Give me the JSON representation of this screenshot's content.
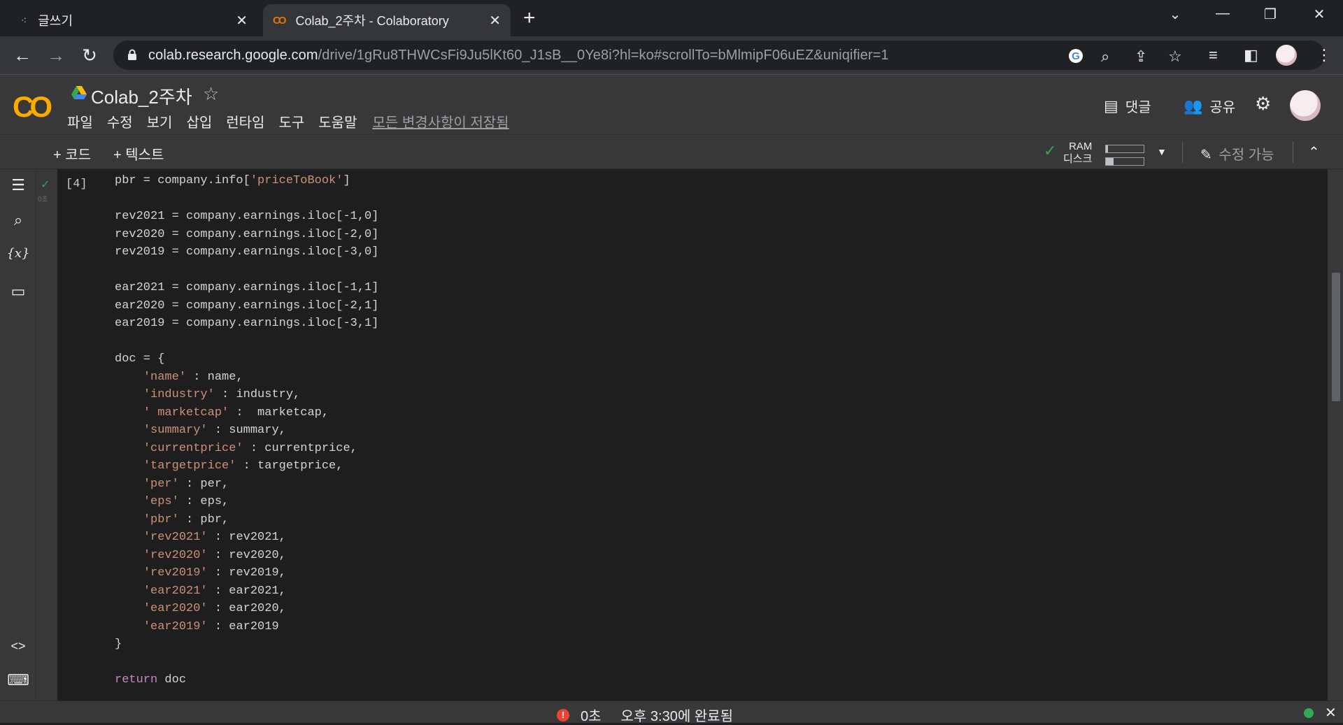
{
  "browser": {
    "tabs": [
      {
        "title": "글쓰기",
        "close": "✕"
      },
      {
        "title": "Colab_2주차 - Colaboratory",
        "close": "✕"
      }
    ],
    "new_tab": "+",
    "url_host": "colab.research.google.com",
    "url_path": "/drive/1gRu8THWCsFi9Ju5lKt60_J1sB__0Ye8i?hl=ko#scrollTo=bMlmipF06uEZ&uniqifier=1"
  },
  "colab": {
    "logo": "CO",
    "notebook_title": "Colab_2주차",
    "menu": [
      "파일",
      "수정",
      "보기",
      "삽입",
      "런타임",
      "도구",
      "도움말"
    ],
    "saved_status": "모든 변경사항이 저장됨",
    "comment_label": "댓글",
    "share_label": "공유",
    "add_code": "+ 코드",
    "add_text": "+ 텍스트",
    "ram_label": "RAM",
    "disk_label": "디스크",
    "ram_usage": 0.06,
    "disk_usage": 0.2,
    "edit_mode": "수정 가능"
  },
  "cell": {
    "exec_count": "[4]",
    "run_time": "0초",
    "code_lines": [
      [
        {
          "t": "pbr = company.info["
        },
        {
          "t": "'priceToBook'",
          "c": "str"
        },
        {
          "t": "]"
        }
      ],
      [],
      [
        {
          "t": "rev2021 = company.earnings.iloc[-1,0]"
        }
      ],
      [
        {
          "t": "rev2020 = company.earnings.iloc[-2,0]"
        }
      ],
      [
        {
          "t": "rev2019 = company.earnings.iloc[-3,0]"
        }
      ],
      [],
      [
        {
          "t": "ear2021 = company.earnings.iloc[-1,1]"
        }
      ],
      [
        {
          "t": "ear2020 = company.earnings.iloc[-2,1]"
        }
      ],
      [
        {
          "t": "ear2019 = company.earnings.iloc[-3,1]"
        }
      ],
      [],
      [
        {
          "t": "doc = {"
        }
      ],
      [
        {
          "t": "    "
        },
        {
          "t": "'name'",
          "c": "str"
        },
        {
          "t": " : name,"
        }
      ],
      [
        {
          "t": "    "
        },
        {
          "t": "'industry'",
          "c": "str"
        },
        {
          "t": " : industry,"
        }
      ],
      [
        {
          "t": "    "
        },
        {
          "t": "' marketcap'",
          "c": "str"
        },
        {
          "t": " :  marketcap,"
        }
      ],
      [
        {
          "t": "    "
        },
        {
          "t": "'summary'",
          "c": "str"
        },
        {
          "t": " : summary,"
        }
      ],
      [
        {
          "t": "    "
        },
        {
          "t": "'currentprice'",
          "c": "str"
        },
        {
          "t": " : currentprice,"
        }
      ],
      [
        {
          "t": "    "
        },
        {
          "t": "'targetprice'",
          "c": "str"
        },
        {
          "t": " : targetprice,"
        }
      ],
      [
        {
          "t": "    "
        },
        {
          "t": "'per'",
          "c": "str"
        },
        {
          "t": " : per,"
        }
      ],
      [
        {
          "t": "    "
        },
        {
          "t": "'eps'",
          "c": "str"
        },
        {
          "t": " : eps,"
        }
      ],
      [
        {
          "t": "    "
        },
        {
          "t": "'pbr'",
          "c": "str"
        },
        {
          "t": " : pbr,"
        }
      ],
      [
        {
          "t": "    "
        },
        {
          "t": "'rev2021'",
          "c": "str"
        },
        {
          "t": " : rev2021,"
        }
      ],
      [
        {
          "t": "    "
        },
        {
          "t": "'rev2020'",
          "c": "str"
        },
        {
          "t": " : rev2020,"
        }
      ],
      [
        {
          "t": "    "
        },
        {
          "t": "'rev2019'",
          "c": "str"
        },
        {
          "t": " : rev2019,"
        }
      ],
      [
        {
          "t": "    "
        },
        {
          "t": "'ear2021'",
          "c": "str"
        },
        {
          "t": " : ear2021,"
        }
      ],
      [
        {
          "t": "    "
        },
        {
          "t": "'ear2020'",
          "c": "str"
        },
        {
          "t": " : ear2020,"
        }
      ],
      [
        {
          "t": "    "
        },
        {
          "t": "'ear2019'",
          "c": "str"
        },
        {
          "t": " : ear2019"
        }
      ],
      [
        {
          "t": "}"
        }
      ],
      [],
      [
        {
          "t": "return",
          "c": "kw"
        },
        {
          "t": " doc"
        }
      ]
    ]
  },
  "status": {
    "elapsed": "0초",
    "completed": "오후 3:30에 완료됨"
  },
  "colors": {
    "accent": "#f9ab00",
    "string": "#ce9178",
    "keyword": "#c586c0",
    "success": "#34a853",
    "error": "#ea4335"
  }
}
